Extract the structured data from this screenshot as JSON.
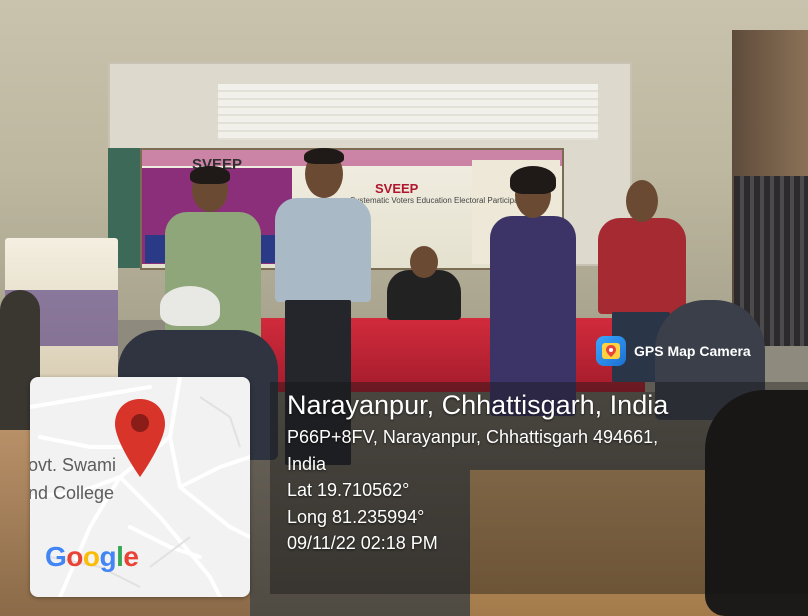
{
  "scene": {
    "banner_left_heading": "SVEEP",
    "banner_right_heading": "SVEEP",
    "banner_right_subheading": "Systematic Voters Education Electoral Participation"
  },
  "watermark": {
    "label": "GPS Map Camera",
    "icon": "gps-map-camera-icon"
  },
  "location": {
    "title": "Narayanpur, Chhattisgarh, India",
    "address_line_1": "P66P+8FV, Narayanpur, Chhattisgarh 494661,",
    "address_line_2": "India",
    "lat": "Lat 19.710562°",
    "long": "Long 81.235994°",
    "datetime": "09/11/22 02:18 PM"
  },
  "map": {
    "place_line_1": "ovt. Swami",
    "place_line_2": "nd College",
    "brand": "Google",
    "pin_icon": "map-pin-icon",
    "colors": {
      "pin": "#d8342a",
      "pin_shadow": "#1e6c8f",
      "road": "#ffffff",
      "bg": "#f2f2f2"
    }
  }
}
